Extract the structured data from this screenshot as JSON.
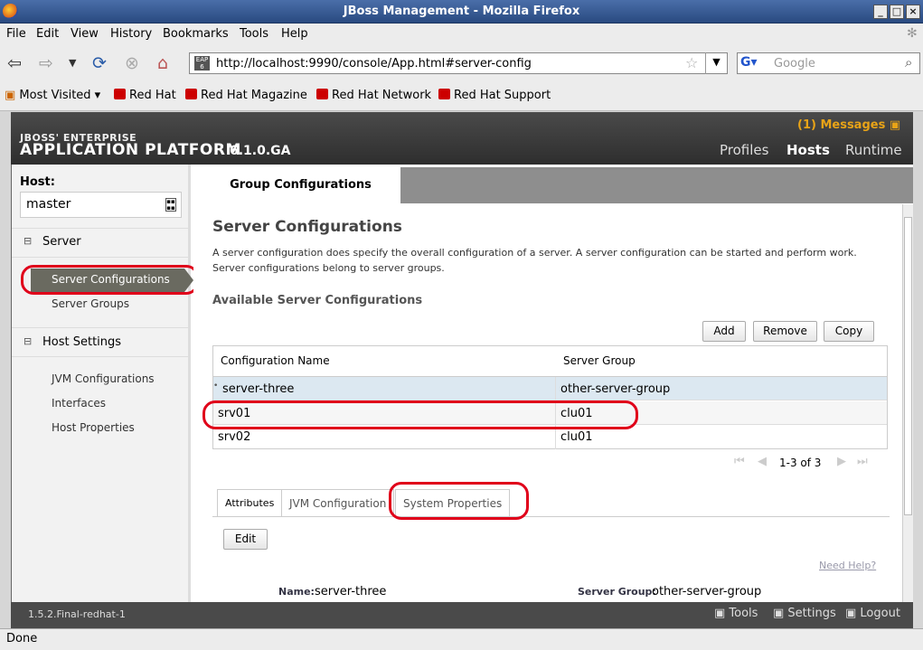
{
  "window": {
    "title": "JBoss Management - Mozilla Firefox"
  },
  "menubar": {
    "items": [
      "File",
      "Edit",
      "View",
      "History",
      "Bookmarks",
      "Tools",
      "Help"
    ]
  },
  "navbar": {
    "url": "http://localhost:9990/console/App.html#server-config",
    "search_placeholder": "Google"
  },
  "bookmarks": {
    "items": [
      "Most Visited",
      "Red Hat",
      "Red Hat Magazine",
      "Red Hat Network",
      "Red Hat Support"
    ]
  },
  "header": {
    "brand_top": "JBOSS' ENTERPRISE",
    "brand_main": "APPLICATION PLATFORM",
    "version": "6.1.0.GA",
    "messages": "(1) Messages",
    "nav": [
      "Profiles",
      "Hosts",
      "Runtime"
    ],
    "active_nav": "Hosts"
  },
  "sidebar": {
    "host_label": "Host:",
    "host_value": "master",
    "server_section": "Server",
    "server_items": [
      "Server Configurations",
      "Server Groups"
    ],
    "host_settings_section": "Host Settings",
    "host_items": [
      "JVM Configurations",
      "Interfaces",
      "Host Properties"
    ]
  },
  "content": {
    "tab": "Group Configurations",
    "title": "Server Configurations",
    "description": "A server configuration does specify the overall configuration of a server. A server configuration can be started and perform work. Server configurations belong to server groups.",
    "subtitle": "Available Server Configurations",
    "buttons": {
      "add": "Add",
      "remove": "Remove",
      "copy": "Copy",
      "edit": "Edit"
    },
    "table": {
      "headers": [
        "Configuration Name",
        "Server Group"
      ],
      "rows": [
        {
          "name": "server-three",
          "group": "other-server-group"
        },
        {
          "name": "srv01",
          "group": "clu01"
        },
        {
          "name": "srv02",
          "group": "clu01"
        }
      ]
    },
    "pager": "1-3 of 3",
    "detail_tabs": [
      "Attributes",
      "JVM Configuration",
      "System Properties"
    ],
    "need_help": "Need Help?",
    "name_label": "Name:",
    "name_value": "server-three",
    "group_label": "Server Group:",
    "group_value": "other-server-group"
  },
  "footer": {
    "version": "1.5.2.Final-redhat-1",
    "tools": "Tools",
    "settings": "Settings",
    "logout": "Logout"
  },
  "status": {
    "text": "Done"
  }
}
